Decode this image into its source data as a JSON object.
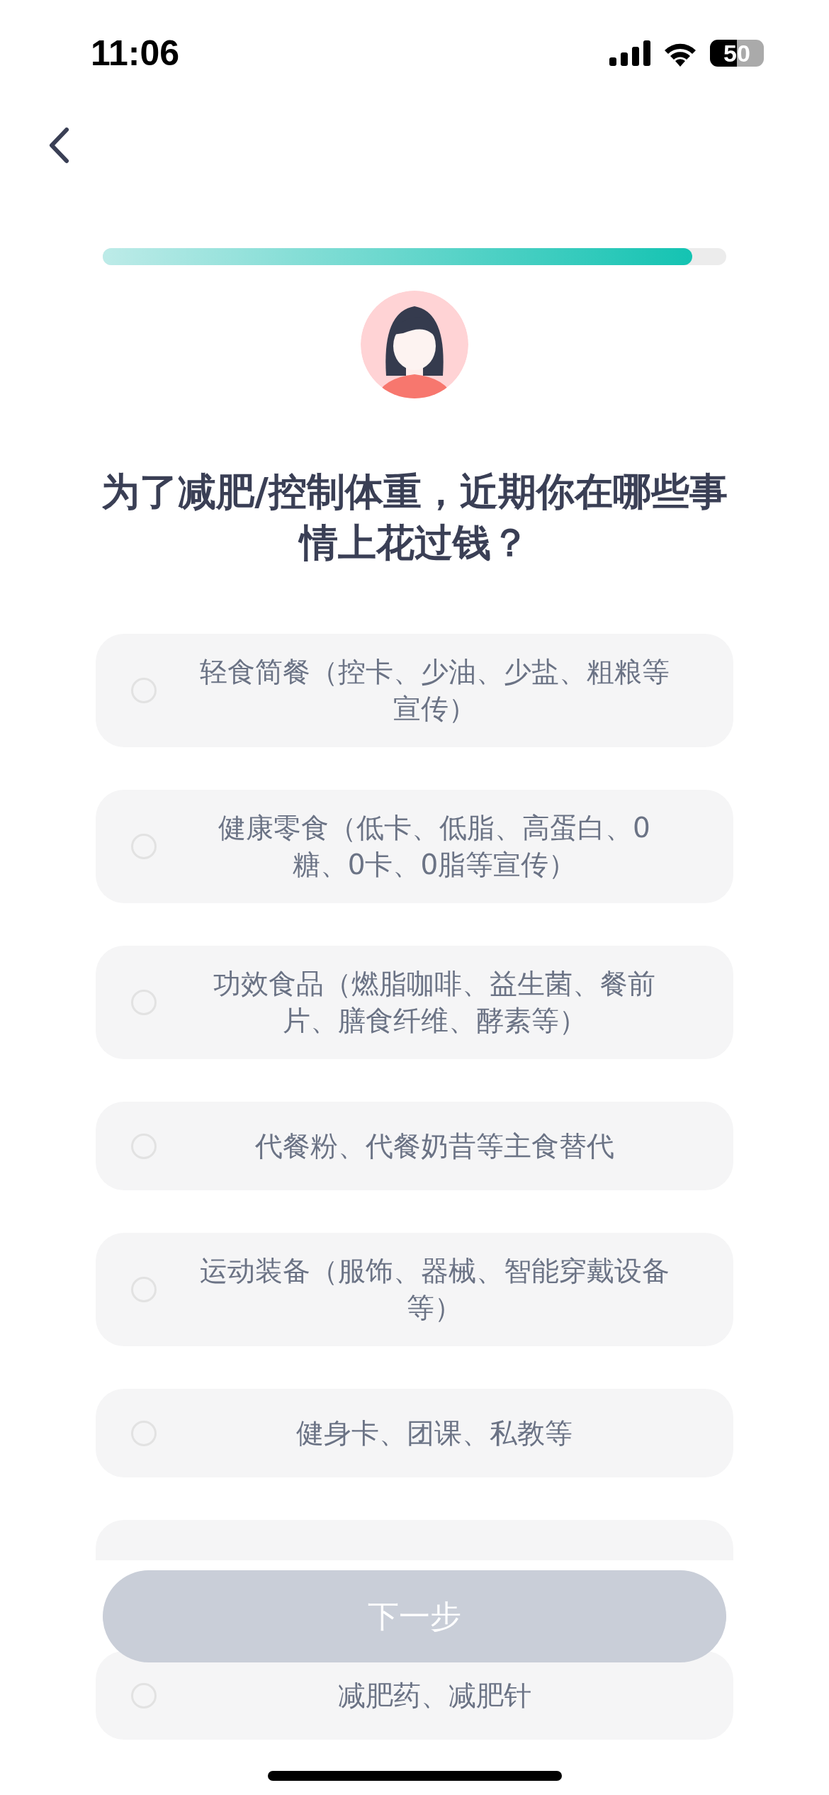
{
  "status_bar": {
    "time": "11:06",
    "battery": "50"
  },
  "progress": {
    "level": 0.945
  },
  "question": "为了减肥/控制体重，近期你在哪些事情上花过钱？",
  "options": [
    {
      "label": "轻食简餐（控卡、少油、少盐、粗粮等宣传）",
      "selected": false
    },
    {
      "label": "健康零食（低卡、低脂、高蛋白、0糖、0卡、0脂等宣传）",
      "selected": false
    },
    {
      "label": "功效食品（燃脂咖啡、益生菌、餐前片、膳食纤维、酵素等）",
      "selected": false
    },
    {
      "label": "代餐粉、代餐奶昔等主食替代",
      "selected": false
    },
    {
      "label": "运动装备（服饰、器械、智能穿戴设备等）",
      "selected": false
    },
    {
      "label": "健身卡、团课、私教等",
      "selected": false
    },
    {
      "kind": "covered"
    },
    {
      "label": "减肥药、减肥针",
      "selected": false
    }
  ],
  "next_button": {
    "label": "下一步",
    "disabled": true
  }
}
